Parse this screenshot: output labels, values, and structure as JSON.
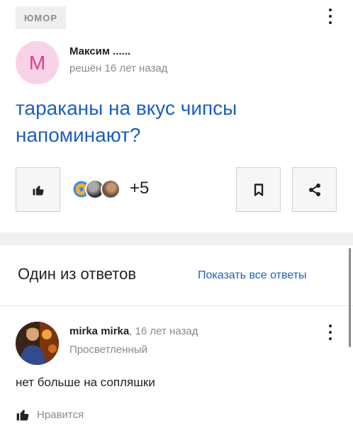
{
  "question_card": {
    "tag": "ЮМОР",
    "author": {
      "initial": "М",
      "name": "Максим ......",
      "solved": "решён 16 лет назад"
    },
    "title": "тараканы на вкус чипсы напоминают?",
    "participants_more": "+5",
    "colors": {
      "link": "#1d5fbf",
      "avatar_bg": "#fad2e7",
      "avatar_letter": "#e23b8a"
    }
  },
  "answers_section": {
    "title": "Один из ответов",
    "show_all": "Показать все ответы"
  },
  "answer": {
    "author": "mirka mirka",
    "time": ", 16 лет назад",
    "rank": "Просветленный",
    "text": "нет больше на сопляшки",
    "like_label": "Нравится"
  }
}
